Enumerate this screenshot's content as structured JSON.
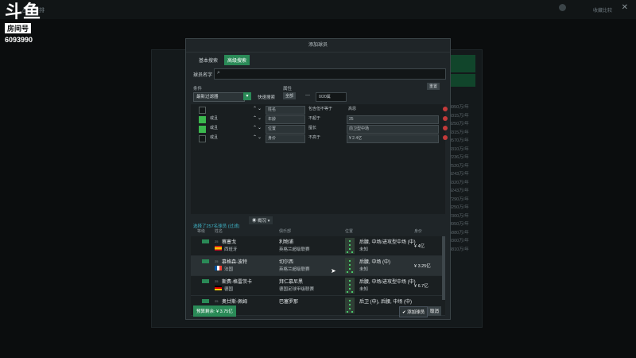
{
  "background": {
    "title": "战略安排",
    "right_text": "收藏比较"
  },
  "logo": {
    "main": "斗鱼",
    "sub": "房间号",
    "room_id": "6093990"
  },
  "dialog": {
    "title": "添加球员",
    "tabs": [
      {
        "label": "基本搜索",
        "active": false
      },
      {
        "label": "高级搜索",
        "active": true
      }
    ],
    "name_label": "球员名字",
    "search_value": "",
    "condition_label": "条件",
    "attribute_label": "属性",
    "reset_label": "重置",
    "filter_select": "最新过滤器",
    "quick_search": "快速搜索",
    "attr_toggle": "全部",
    "range_dash": "—",
    "range_select": "0/20属",
    "criteria": [
      {
        "checked": false,
        "c1": "",
        "c2": "",
        "c3": "姓名",
        "c4": "包含但不等于",
        "c5": "高恩",
        "c5dd": false
      },
      {
        "checked": true,
        "c1": "或且",
        "c2": "",
        "c3": "年龄",
        "c4": "不超于",
        "c5": "25",
        "c5dd": true
      },
      {
        "checked": true,
        "c1": "或且",
        "c2": "",
        "c3": "位置",
        "c4": "擅长",
        "c5": "前卫型中场",
        "c5dd": true
      },
      {
        "checked": false,
        "c1": "或且",
        "c2": "",
        "c3": "身价",
        "c4": "不高于",
        "c5": "¥ 2.4亿",
        "c5dd": true
      }
    ],
    "selection_text": "选择了257名球员 (过滤)",
    "view_label": "概况",
    "headers": [
      "等级",
      "姓名",
      "俱乐部",
      "位置",
      "身价"
    ],
    "players": [
      {
        "pos": "25",
        "name": "蔡塞戈",
        "nationality": "西班牙",
        "club": "利物浦",
        "league": "英格兰超级联赛",
        "role": "后腰, 中场/进攻型中场 (中)",
        "role2": "未知",
        "value": "¥ 4亿",
        "highlight": false,
        "flag": "es"
      },
      {
        "pos": "25",
        "name": "慕格森-波特",
        "nationality": "法国",
        "club": "切尔西",
        "league": "英格兰超级联赛",
        "role": "后腰, 中场 (中)",
        "role2": "未知",
        "value": "¥ 3.25亿",
        "highlight": true,
        "flag": "fr"
      },
      {
        "pos": "25",
        "name": "斯费-格雷茨卡",
        "nationality": "德国",
        "club": "拜仁慕尼黑",
        "league": "德国足球甲级联赛",
        "role": "后腰, 中场/进攻型中场 (中)",
        "role2": "未知",
        "value": "¥ 6.7亿",
        "highlight": false,
        "flag": "de"
      },
      {
        "pos": "25",
        "name": "奥廿斯-佩姆",
        "nationality": "",
        "club": "巴塞罗那",
        "league": "",
        "role": "后卫 (中), 后腰, 中场 (中)",
        "role2": "",
        "value": "",
        "highlight": false,
        "flag": "es"
      }
    ],
    "budget_label": "预算剩余: ¥ 3.75亿",
    "confirm_label": "添加球员",
    "cancel_label": "取消"
  },
  "bg_list": [
    "4950万/年",
    "4315万/年",
    "3250万/年",
    "3315万/年",
    "9570万/年",
    "3310万/年",
    "2236万/年",
    "2520万/年",
    "4243万/年",
    "3320万/年",
    "4243万/年",
    "7290万/年",
    "3250万/年",
    "2300万/年",
    "8950万/年",
    "5880万/年",
    "9300万/年",
    "3810万/年"
  ],
  "colors": {
    "accent": "#2a8a57",
    "danger": "#c43a3a",
    "link": "#3fb6c9"
  }
}
